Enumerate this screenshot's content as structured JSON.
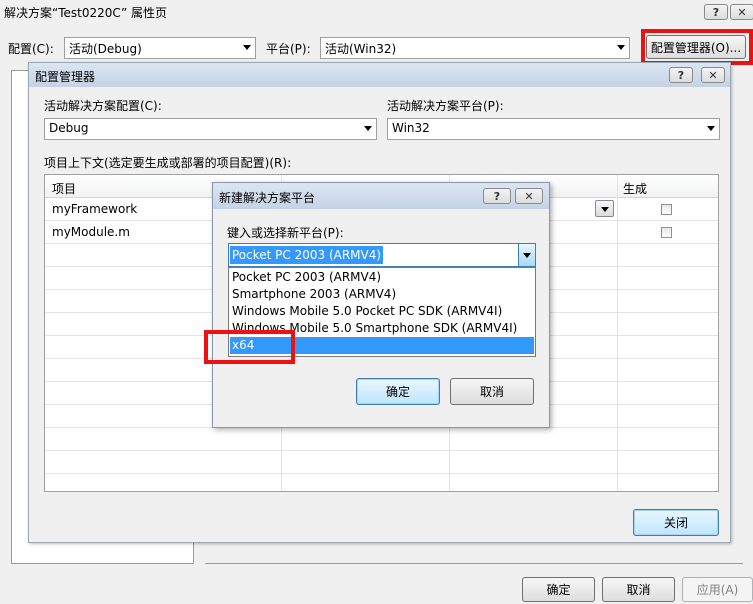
{
  "outer": {
    "title": "解决方案“Test0220C” 属性页",
    "config_label": "配置(C):",
    "config_value": "活动(Debug)",
    "platform_label": "平台(P):",
    "platform_value": "活动(Win32)",
    "config_manager_button": "配置管理器(O)...",
    "ok_button": "确定",
    "cancel_button": "取消",
    "apply_button": "应用(A)"
  },
  "config_manager": {
    "title": "配置管理器",
    "active_config_label": "活动解决方案配置(C):",
    "active_config_value": "Debug",
    "active_platform_label": "活动解决方案平台(P):",
    "active_platform_value": "Win32",
    "project_context_label": "项目上下文(选定要生成或部署的项目配置)(R):",
    "columns": [
      "项目",
      "",
      "",
      "生成"
    ],
    "rows": [
      {
        "project": "myFramework"
      },
      {
        "project": "myModule.m"
      }
    ],
    "close_button": "关闭"
  },
  "new_platform": {
    "title": "新建解决方案平台",
    "type_label": "键入或选择新平台(P):",
    "current_value": "Pocket PC 2003 (ARMV4)",
    "options": [
      "Pocket PC 2003 (ARMV4)",
      "Smartphone 2003 (ARMV4)",
      "Windows Mobile 5.0 Pocket PC SDK (ARMV4I)",
      "Windows Mobile 5.0 Smartphone SDK (ARMV4I)",
      "x64"
    ],
    "ok_button": "确定",
    "cancel_button": "取消"
  },
  "title_buttons": {
    "help": "?",
    "close": "✕"
  }
}
